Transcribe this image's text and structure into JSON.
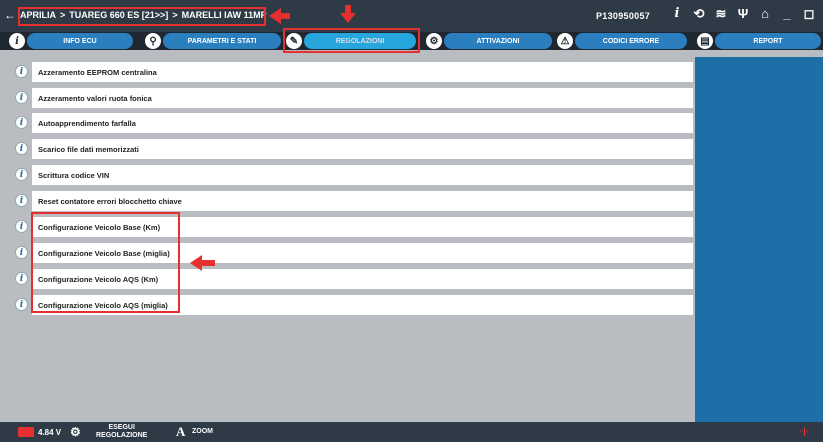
{
  "header": {
    "back_label": "←",
    "breadcrumb": [
      "APRILIA",
      "TUAREG 660 ES [21>>]",
      "MARELLI IAW 11MP"
    ],
    "separator": ">",
    "serial": "P130950057",
    "icons": [
      "info-icon",
      "history-icon",
      "connection-icon",
      "usb-icon",
      "home-icon",
      "minimize-icon",
      "window-icon",
      "power-icon"
    ]
  },
  "tabs": [
    {
      "label": "INFO ECU",
      "icon": "i"
    },
    {
      "label": "PARAMETRI E STATI",
      "icon": "⚲"
    },
    {
      "label": "REGOLAZIONI",
      "icon": "✎"
    },
    {
      "label": "ATTIVAZIONI",
      "icon": "⚙"
    },
    {
      "label": "CODICI ERRORE",
      "icon": "⚠"
    },
    {
      "label": "REPORT",
      "icon": "▤"
    }
  ],
  "active_tab": "REGOLAZIONI",
  "list": {
    "items": [
      "Azzeramento EEPROM centralina",
      "Azzeramento valori ruota fonica",
      "Autoapprendimento farfalla",
      "Scarico file dati memorizzati",
      "Scrittura codice VIN",
      "Reset contatore errori blocchetto chiave",
      "Configurazione Veicolo Base (Km)",
      "Configurazione Veicolo Base (miglia)",
      "Configurazione Veicolo AQS (Km)",
      "Configurazione Veicolo AQS (miglia)"
    ],
    "info_glyph": "i"
  },
  "footer": {
    "voltage": "4.84 V",
    "exec_line1": "ESEGUI",
    "exec_line2": "REGOLAZIONE",
    "zoom_glyph": "A",
    "zoom_label": "ZOOM"
  },
  "colors": {
    "accent": "#26a6dc",
    "tab": "#2b7fbf",
    "highlight": "#e53030",
    "panel": "#1e6ea8"
  }
}
